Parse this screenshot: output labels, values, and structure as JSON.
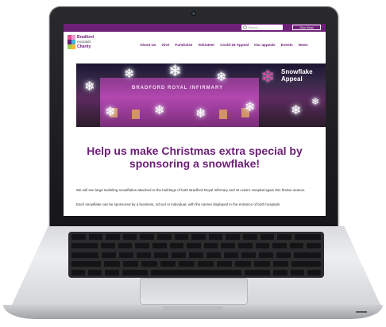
{
  "browser": {
    "search_placeholder": "Search",
    "give_button": "Give Now"
  },
  "site": {
    "logo_line1": "Bradford",
    "logo_line2": "Hospitals'",
    "logo_line3": "Charity",
    "nav": [
      "About Us",
      "Give",
      "Fundraise",
      "Volunteer",
      "Covid-19 Appeal",
      "Our appeals",
      "Events",
      "News"
    ]
  },
  "hero": {
    "building_sign": "BRADFORD ROYAL INFIRMARY",
    "appeal_title_line1": "Snowflake",
    "appeal_title_line2": "Appeal"
  },
  "content": {
    "headline": "Help us make Christmas extra special by sponsoring a snowflake!",
    "paragraph1": "We will see large twinkling snowflakes attached to the buildings of both Bradford Royal Infirmary and St Luke's Hospital again this festive season.",
    "paragraph2": "Each snowflake can be sponsored by a business, school or individual, with the names displayed in the entrance of both hospitals."
  },
  "colors": {
    "brand_purple": "#6d2077",
    "appeal_pink": "#e24b9a"
  }
}
